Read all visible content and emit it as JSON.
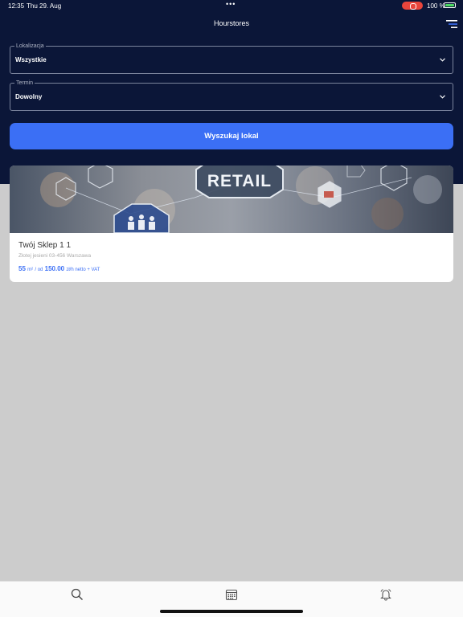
{
  "status_bar": {
    "time": "12:35",
    "date": "Thu 29. Aug",
    "battery": "100 %"
  },
  "header": {
    "title": "Hourstores"
  },
  "filters": {
    "location": {
      "label": "Lokalizacja",
      "value": "Wszystkie"
    },
    "term": {
      "label": "Termin",
      "value": "Dowolny"
    }
  },
  "search_button": {
    "label": "Wyszukaj lokal"
  },
  "listing": {
    "image_text": "RETAIL",
    "title": "Twój Sklep 1 1",
    "address": "Złotej jesieni 03-456  Warszawa",
    "area": "55",
    "area_unit": "m²",
    "separator": "/ od",
    "price": "150.00",
    "price_unit": "zł/h netto + VAT"
  },
  "tabs": [
    {
      "icon": "search-icon"
    },
    {
      "icon": "calendar-icon"
    },
    {
      "icon": "bell-icon"
    }
  ],
  "colors": {
    "header_bg": "#0b1638",
    "accent": "#3b6ff5",
    "content_bg": "#cccccc"
  }
}
